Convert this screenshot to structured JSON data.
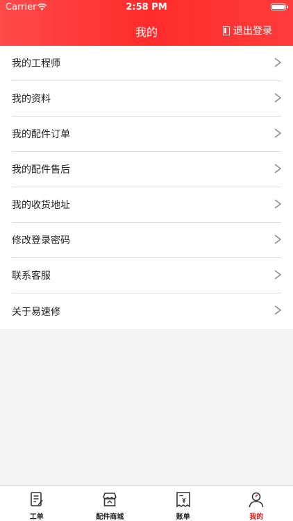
{
  "status_bar": {
    "carrier": "Carrier",
    "time": "2:58 PM"
  },
  "header": {
    "title": "我的",
    "logout_label": "退出登录"
  },
  "menu": {
    "items": [
      {
        "label": "我的工程师"
      },
      {
        "label": "我的资料"
      },
      {
        "label": "我的配件订单"
      },
      {
        "label": "我的配件售后"
      },
      {
        "label": "我的收货地址"
      },
      {
        "label": "修改登录密码"
      },
      {
        "label": "联系客服"
      },
      {
        "label": "关于易速修"
      }
    ]
  },
  "tabbar": {
    "items": [
      {
        "label": "工单",
        "icon": "work-order-icon"
      },
      {
        "label": "配件商城",
        "icon": "store-icon"
      },
      {
        "label": "账单",
        "icon": "bill-icon"
      },
      {
        "label": "我的",
        "icon": "profile-icon",
        "active": true
      }
    ],
    "active_color": "#e02020"
  },
  "colors": {
    "header_accent": "#ff3b3b"
  }
}
